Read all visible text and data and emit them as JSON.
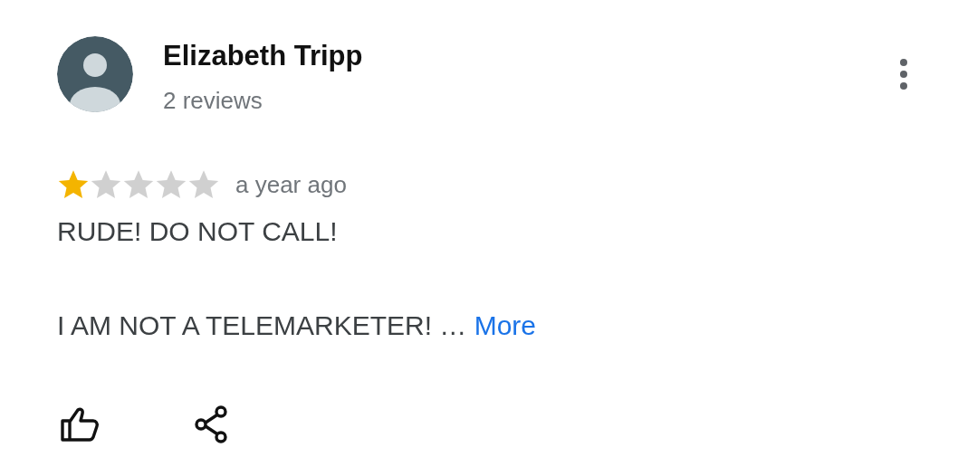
{
  "reviewer": {
    "name": "Elizabeth Tripp",
    "review_count": "2 reviews"
  },
  "rating": {
    "stars": 1
  },
  "time": "a year ago",
  "review": {
    "text": "RUDE! DO NOT CALL!\n\nI AM NOT A TELEMARKETER! …",
    "more_link": "More"
  }
}
